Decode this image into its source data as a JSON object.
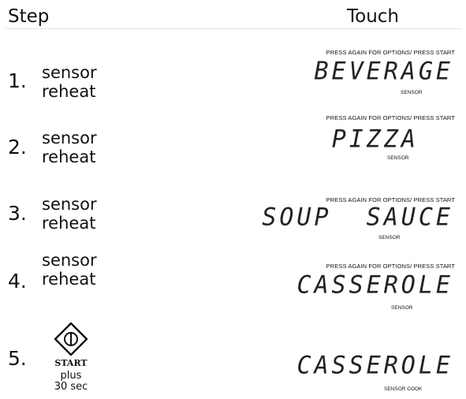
{
  "header": {
    "step_label": "Step",
    "touch_label": "Touch"
  },
  "steps": [
    {
      "number": "1.",
      "lines": [
        "sensor",
        "reheat"
      ],
      "caption": "PRESS AGAIN FOR OPTIONS/  PRESS START",
      "display": "BEVERAGE",
      "sub": "SENSOR"
    },
    {
      "number": "2.",
      "lines": [
        "sensor",
        "reheat"
      ],
      "caption": "PRESS AGAIN FOR OPTIONS/  PRESS START",
      "display": "PIZZA",
      "sub": "SENSOR"
    },
    {
      "number": "3.",
      "lines": [
        "sensor",
        "reheat"
      ],
      "caption": "PRESS AGAIN FOR OPTIONS/  PRESS START",
      "display": "SOUP  SAUCE",
      "sub": "SENSOR"
    },
    {
      "number": "4.",
      "lines": [
        "sensor",
        "reheat"
      ],
      "caption": "PRESS AGAIN FOR OPTIONS/  PRESS START",
      "display": "CASSEROLE",
      "sub": "SENSOR"
    },
    {
      "number": "5.",
      "start_label": "START",
      "plus_lines": [
        "plus",
        "30 sec"
      ],
      "display": "CASSEROLE",
      "sub": "SENSOR COOK"
    }
  ],
  "icons": {
    "start": "start-diamond-icon"
  }
}
